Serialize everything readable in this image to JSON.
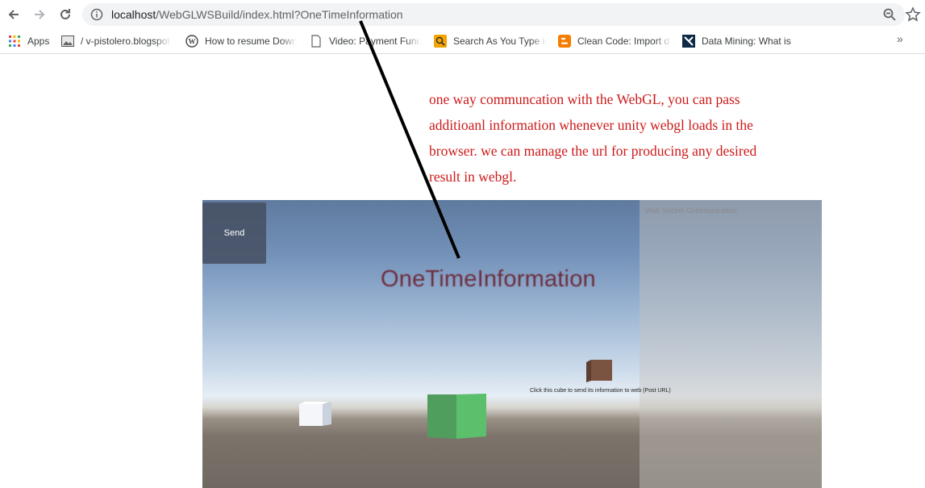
{
  "browser": {
    "url_host": "localhost",
    "url_path": "/WebGLWSBuild/index.html?OneTimeInformation"
  },
  "bookmarks": [
    {
      "icon": "apps-grid-icon",
      "label": "Apps"
    },
    {
      "icon": "image-favicon-icon",
      "label": "/ v-pistolero.blogspot"
    },
    {
      "icon": "wordpress-icon",
      "label": "How to resume Down"
    },
    {
      "icon": "document-icon",
      "label": "Video: Payment Fund"
    },
    {
      "icon": "search-favicon-icon",
      "label": "Search As You Type in"
    },
    {
      "icon": "blogger-icon",
      "label": "Clean Code: Import d"
    },
    {
      "icon": "data-mining-icon",
      "label": "Data Mining: What is"
    }
  ],
  "annotation": {
    "line1": "one way communcation with the WebGL, you can pass",
    "line2": "additioanl information whenever unity webgl loads in the",
    "line3": "browser. we can manage the url for producing any desired",
    "line4": "result in webgl."
  },
  "unity": {
    "send_label": "Send",
    "big_label": "OneTimeInformation",
    "ws_title": "Web Socket Communication:",
    "cube_hint": "Click this cube to send its information to web (Post URL)"
  },
  "colors": {
    "annotation": "#cc1a1a",
    "big_label": "#6e2d3e",
    "green_cube": "#4f9e5e",
    "brown_cube": "#7a5441"
  }
}
